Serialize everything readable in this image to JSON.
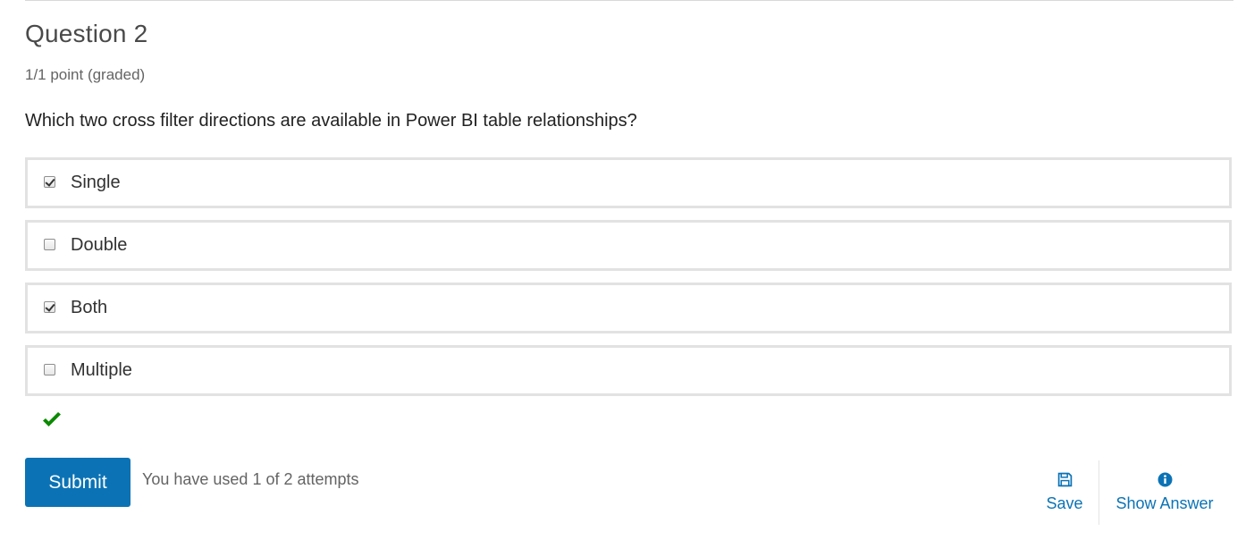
{
  "question": {
    "title": "Question 2",
    "points": "1/1 point (graded)",
    "prompt": "Which two cross filter directions are available in Power BI table relationships?"
  },
  "choices": [
    {
      "label": "Single",
      "checked": true
    },
    {
      "label": "Double",
      "checked": false
    },
    {
      "label": "Both",
      "checked": true
    },
    {
      "label": "Multiple",
      "checked": false
    }
  ],
  "status": {
    "icon": "checkmark-icon",
    "color": "#0a8a00"
  },
  "actions": {
    "submit_label": "Submit",
    "attempts_text": "You have used 1 of 2 attempts",
    "save_label": "Save",
    "save_icon": "floppy-disk-icon",
    "show_answer_label": "Show Answer",
    "show_answer_icon": "info-circle-icon"
  },
  "colors": {
    "accent": "#0b73b5",
    "correct": "#0a8a00",
    "choice_border": "#e2e2e2"
  }
}
